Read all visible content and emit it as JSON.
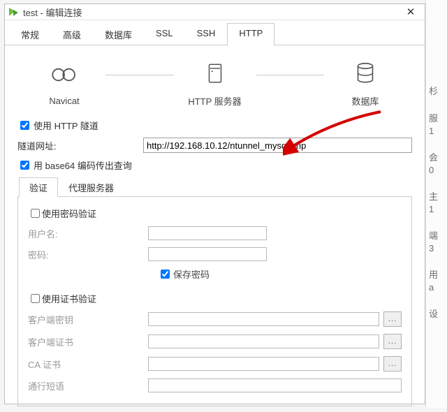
{
  "window": {
    "title": "test - 编辑连接",
    "close": "✕"
  },
  "tabs": [
    "常规",
    "高级",
    "数据库",
    "SSL",
    "SSH",
    "HTTP"
  ],
  "active_tab": 5,
  "diagram": {
    "navicat": "Navicat",
    "httpserver": "HTTP 服务器",
    "database": "数据库"
  },
  "main": {
    "use_tunnel_label": "使用 HTTP 隧道",
    "use_tunnel_checked": true,
    "tunnel_url_label": "隧道网址:",
    "tunnel_url": "http://192.168.10.12/ntunnel_mysql.php",
    "base64_label": "用 base64 编码传出查询",
    "base64_checked": true
  },
  "subtabs": [
    "验证",
    "代理服务器"
  ],
  "active_subtab": 0,
  "auth_panel": {
    "use_password_label": "使用密码验证",
    "use_password_checked": false,
    "username_label": "用户名:",
    "username": "",
    "password_label": "密码:",
    "password": "",
    "save_password_label": "保存密码",
    "save_password_checked": true,
    "use_cert_label": "使用证书验证",
    "use_cert_checked": false,
    "client_key_label": "客户端密钥",
    "client_key": "",
    "client_cert_label": "客户端证书",
    "client_cert": "",
    "ca_cert_label": "CA 证书",
    "ca_cert": "",
    "passphrase_label": "通行短语",
    "passphrase": "",
    "browse": "..."
  },
  "behind": {
    "t1": "杉",
    "t2": "服",
    "t21": "1",
    "t3": "会",
    "t31": "0",
    "t4": "主",
    "t41": "1",
    "t5": "端",
    "t51": "3",
    "t6": "用",
    "t61": "a",
    "t7": "设"
  }
}
